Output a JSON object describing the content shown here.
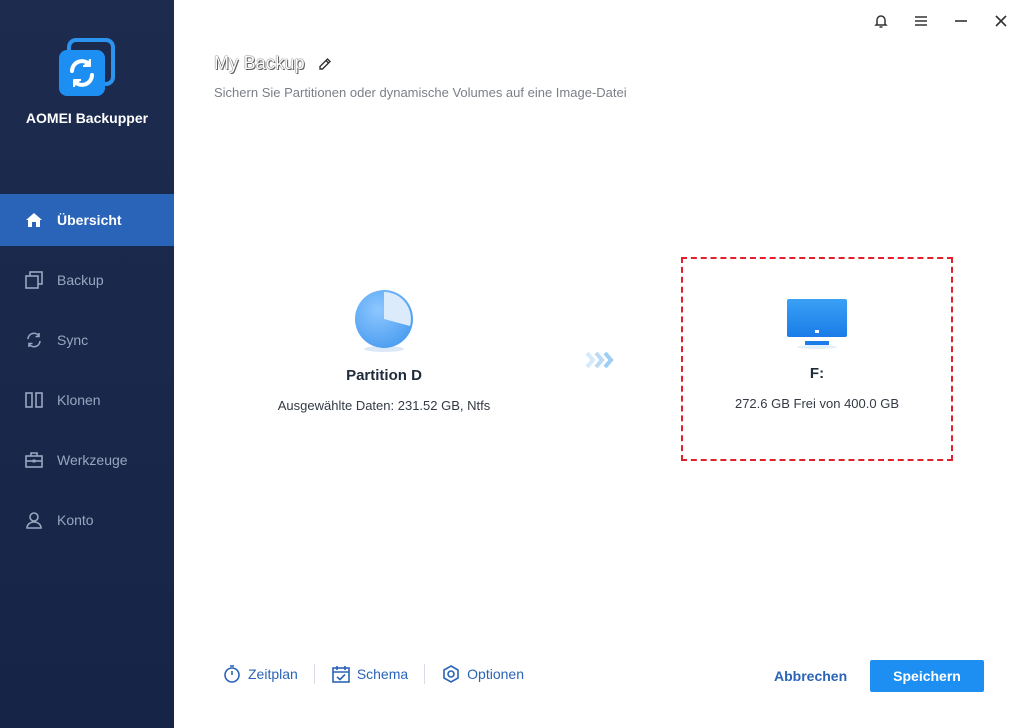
{
  "app": {
    "name": "AOMEI Backupper"
  },
  "sidebar": {
    "items": [
      {
        "label": "Übersicht",
        "icon": "home-icon",
        "active": true
      },
      {
        "label": "Backup",
        "icon": "backup-icon",
        "active": false
      },
      {
        "label": "Sync",
        "icon": "sync-icon",
        "active": false
      },
      {
        "label": "Klonen",
        "icon": "clone-icon",
        "active": false
      },
      {
        "label": "Werkzeuge",
        "icon": "toolbox-icon",
        "active": false
      },
      {
        "label": "Konto",
        "icon": "user-icon",
        "active": false
      }
    ]
  },
  "window": {
    "controls": [
      "bell-icon",
      "menu-icon",
      "minimize-icon",
      "close-icon"
    ]
  },
  "header": {
    "title": "My Backup",
    "subtitle": "Sichern Sie Partitionen oder dynamische Volumes auf eine Image-Datei"
  },
  "source": {
    "name": "Partition D",
    "info": "Ausgewählte Daten: 231.52 GB, Ntfs",
    "icon": "pie-chart-icon"
  },
  "destination": {
    "name": "F:",
    "info": "272.6 GB Frei von 400.0 GB",
    "icon": "monitor-icon"
  },
  "footer": {
    "schedule_label": "Zeitplan",
    "scheme_label": "Schema",
    "options_label": "Optionen",
    "cancel_label": "Abbrechen",
    "save_label": "Speichern"
  },
  "colors": {
    "sidebar_bg": "#1d2b4f",
    "active_item": "#2a64b8",
    "accent": "#1e8ff2",
    "highlight_border": "#e0202a"
  }
}
